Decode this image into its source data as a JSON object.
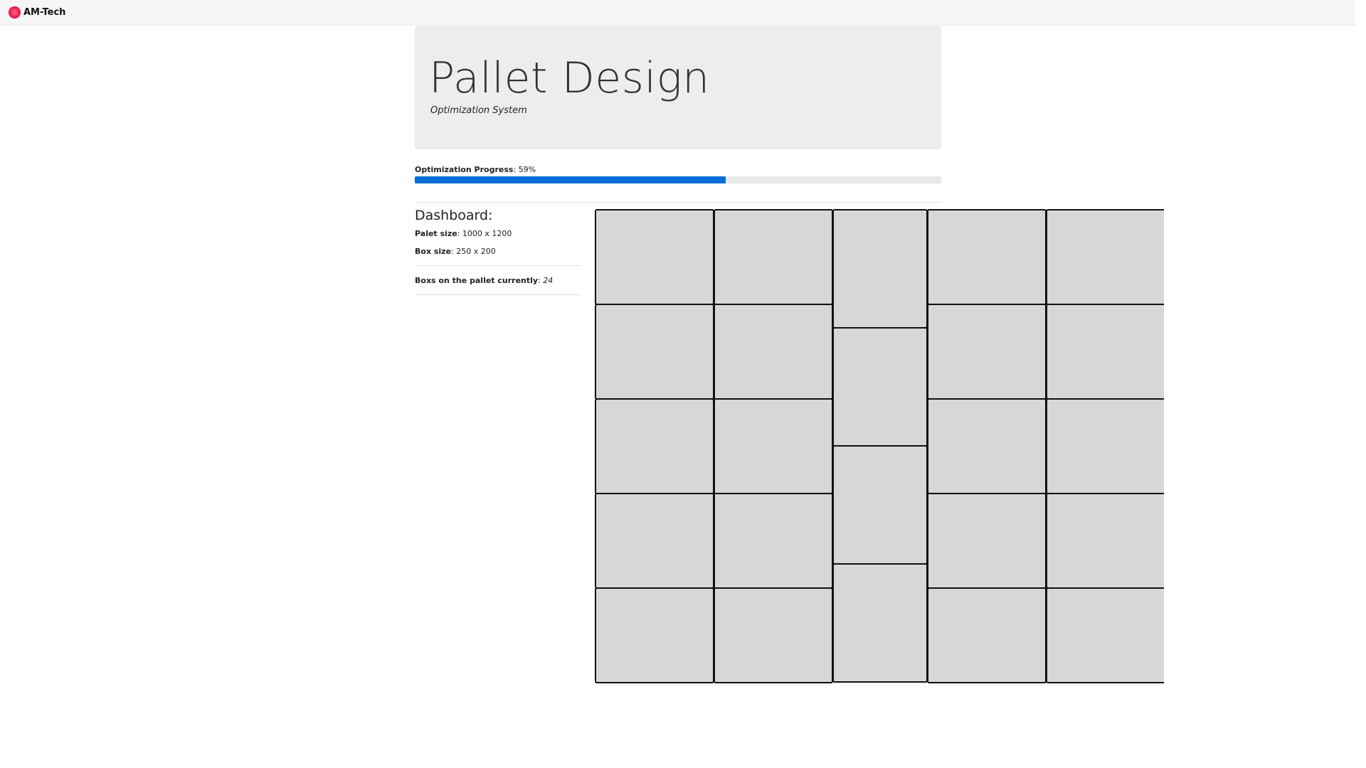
{
  "navbar": {
    "brand": "AM-Tech",
    "logo_icon": "flower-logo-icon"
  },
  "header": {
    "title": "Pallet Design",
    "subtitle": "Optimization System"
  },
  "progress": {
    "label": "Optimization Progress",
    "value_text": "59%",
    "value": 59,
    "color": "#0a6fd6"
  },
  "dashboard": {
    "title": "Dashboard:",
    "palet_size_label": "Palet size",
    "palet_size_value": "1000 x 1200",
    "box_size_label": "Box size",
    "box_size_value": "250 x 200",
    "boxes_label": "Boxs on the pallet currently",
    "boxes_value": "24"
  }
}
